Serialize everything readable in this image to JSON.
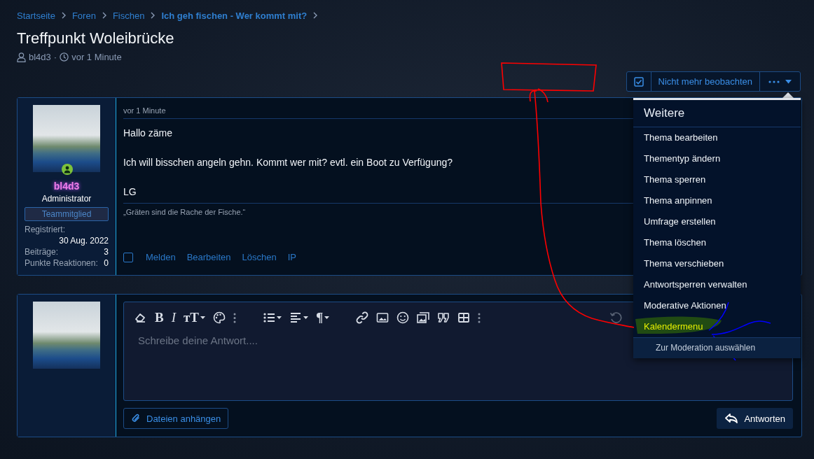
{
  "breadcrumbs": [
    {
      "label": "Startseite",
      "current": false
    },
    {
      "label": "Foren",
      "current": false
    },
    {
      "label": "Fischen",
      "current": false
    },
    {
      "label": "Ich geh fischen - Wer kommt mit?",
      "current": true
    }
  ],
  "title": "Treffpunkt Woleibrücke",
  "meta": {
    "author": "bl4d3",
    "separator": "·",
    "time": "vor 1 Minute"
  },
  "watch": {
    "checked": true,
    "label": "Nicht mehr beobachten"
  },
  "menu": {
    "title": "Weitere",
    "items": [
      {
        "label": "Thema bearbeiten",
        "highlighted": false
      },
      {
        "label": "Thementyp ändern",
        "highlighted": false
      },
      {
        "label": "Thema sperren",
        "highlighted": false
      },
      {
        "label": "Thema anpinnen",
        "highlighted": false
      },
      {
        "label": "Umfrage erstellen",
        "highlighted": false
      },
      {
        "label": "Thema löschen",
        "highlighted": false
      },
      {
        "label": "Thema verschieben",
        "highlighted": false
      },
      {
        "label": "Antwortsperren verwalten",
        "highlighted": false
      },
      {
        "label": "Moderative Aktionen",
        "highlighted": false
      },
      {
        "label": "Kalendermenu",
        "highlighted": true
      }
    ],
    "footer_item": "Zur Moderation auswählen"
  },
  "post": {
    "user": {
      "name": "bl4d3",
      "role": "Administrator",
      "banner": "Teammitglied",
      "online": true,
      "stats": [
        {
          "label": "Registriert:",
          "value": "30 Aug. 2022",
          "kind": "stacked"
        },
        {
          "label": "Beiträge:",
          "value": "3",
          "kind": "inline"
        },
        {
          "label": "Punkte Reaktionen:",
          "value": "0",
          "kind": "inline"
        }
      ]
    },
    "time": "vor 1 Minute",
    "paragraphs": [
      "Hallo zäme",
      "Ich will bisschen angeln gehn. Kommt wer mit? evtl. ein Boot zu Verfügung?",
      "LG"
    ],
    "signature": "„Gräten sind die Rache der Fische.“",
    "selected": false,
    "actions": [
      "Melden",
      "Bearbeiten",
      "Löschen",
      "IP"
    ]
  },
  "reply": {
    "toolbar": [
      {
        "kind": "eraser",
        "dropdown": false
      },
      {
        "kind": "bold",
        "label": "B",
        "dropdown": false
      },
      {
        "kind": "italic",
        "label": "I",
        "dropdown": false
      },
      {
        "kind": "font-size",
        "label": "тT",
        "dropdown": true
      },
      {
        "kind": "palette",
        "dropdown": false
      },
      {
        "kind": "more",
        "dropdown": false
      },
      {
        "kind": "gap"
      },
      {
        "kind": "list",
        "dropdown": true
      },
      {
        "kind": "align",
        "dropdown": true
      },
      {
        "kind": "paragraph",
        "label": "¶",
        "dropdown": true
      },
      {
        "kind": "gap"
      },
      {
        "kind": "link",
        "dropdown": false
      },
      {
        "kind": "image",
        "dropdown": false
      },
      {
        "kind": "smiley",
        "dropdown": false
      },
      {
        "kind": "media",
        "dropdown": false
      },
      {
        "kind": "quote",
        "dropdown": false
      },
      {
        "kind": "table",
        "dropdown": false
      },
      {
        "kind": "more",
        "dropdown": false
      }
    ],
    "undo": {
      "disabled": true
    },
    "placeholder": "Schreibe deine Antwort....",
    "attach": "Dateien anhängen",
    "submit": "Antworten"
  }
}
